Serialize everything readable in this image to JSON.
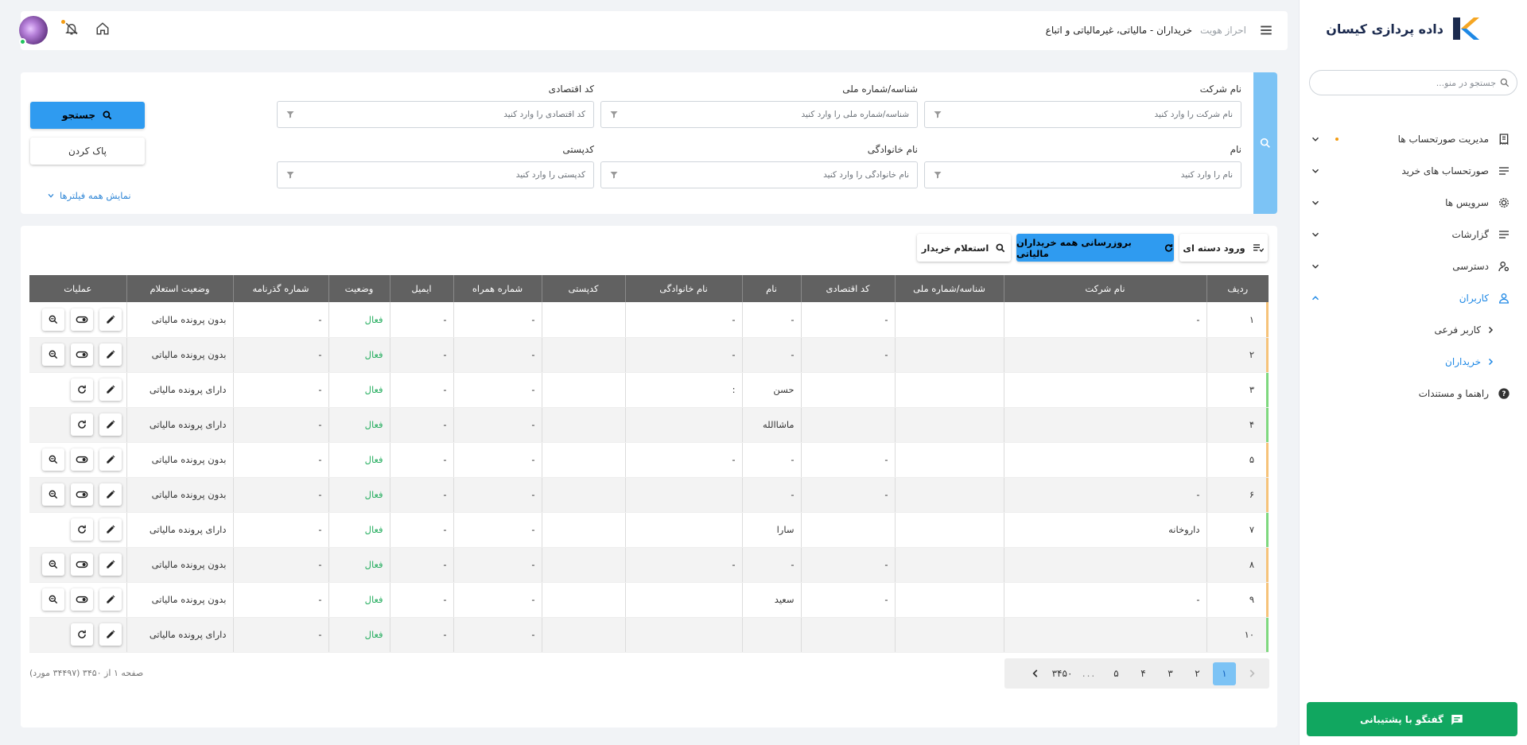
{
  "sidebar": {
    "logo_text": "داده پردازی کیسان",
    "search_placeholder": "جستجو در منو...",
    "items": [
      {
        "label": "مدیریت صورتحساب ها"
      },
      {
        "label": "صورتحساب های خرید"
      },
      {
        "label": "سرویس ها"
      },
      {
        "label": "گزارشات"
      },
      {
        "label": "دسترسی"
      },
      {
        "label": "کاربران"
      }
    ],
    "sub_items": [
      {
        "label": "کاربر فرعی"
      },
      {
        "label": "خریداران"
      }
    ],
    "help": {
      "label": "راهنما و مستندات"
    },
    "support_button": "گفتگو با پشتیبانی"
  },
  "header": {
    "breadcrumb_parent": "احراز هویت",
    "breadcrumb_current": "خریداران - مالیاتی، غیرمالیاتی و اتباع"
  },
  "filters": {
    "company_name": {
      "label": "نام شرکت",
      "placeholder": "نام شرکت را وارد کنید"
    },
    "national_id": {
      "label": "شناسه/شماره ملی",
      "placeholder": "شناسه/شماره ملی را وارد کنید"
    },
    "economic_code": {
      "label": "کد اقتصادی",
      "placeholder": "کد اقتصادی را وارد کنید"
    },
    "first_name": {
      "label": "نام",
      "placeholder": "نام را وارد کنید"
    },
    "last_name": {
      "label": "نام خانوادگی",
      "placeholder": "نام خانوادگی را وارد کنید"
    },
    "postal_code": {
      "label": "کدپستی",
      "placeholder": "کدپستی را وارد کنید"
    },
    "search_button": "جستجو",
    "clear_button": "پاک کردن",
    "show_all": "نمایش همه فیلترها"
  },
  "toolbar": {
    "bulk_import": "ورود دسته ای",
    "update_all": "بروزرسانی همه خریداران مالیاتی",
    "inquiry": "استعلام خریدار"
  },
  "table": {
    "columns": [
      "ردیف",
      "نام شرکت",
      "شناسه/شماره ملی",
      "کد اقتصادی",
      "نام",
      "نام خانوادگی",
      "کدپستی",
      "شماره همراه",
      "ایمیل",
      "وضعیت",
      "شماره گذرنامه",
      "وضعیت استعلام",
      "عملیات"
    ],
    "rows": [
      {
        "idx": "۱",
        "company": "-",
        "national": "",
        "econ": "-",
        "name": "-",
        "family": "-",
        "postal": "",
        "mobile": "-",
        "email": "-",
        "status": "فعال",
        "passport": "-",
        "inquiry": "بدون پرونده مالیاتی"
      },
      {
        "idx": "۲",
        "company": "",
        "national": "",
        "econ": "-",
        "name": "-",
        "family": "-",
        "postal": "",
        "mobile": "-",
        "email": "-",
        "status": "فعال",
        "passport": "-",
        "inquiry": "بدون پرونده مالیاتی"
      },
      {
        "idx": "۳",
        "company": "",
        "national": "",
        "econ": "",
        "name": "حسن",
        "family": ":",
        "postal": "",
        "mobile": "-",
        "email": "-",
        "status": "فعال",
        "passport": "-",
        "inquiry": "دارای پرونده مالیاتی"
      },
      {
        "idx": "۴",
        "company": "",
        "national": "",
        "econ": "",
        "name": "ماشاالله",
        "family": "",
        "postal": "",
        "mobile": "-",
        "email": "-",
        "status": "فعال",
        "passport": "-",
        "inquiry": "دارای پرونده مالیاتی"
      },
      {
        "idx": "۵",
        "company": "",
        "national": "",
        "econ": "-",
        "name": "-",
        "family": "-",
        "postal": "",
        "mobile": "-",
        "email": "-",
        "status": "فعال",
        "passport": "-",
        "inquiry": "بدون پرونده مالیاتی"
      },
      {
        "idx": "۶",
        "company": "-",
        "national": "",
        "econ": "-",
        "name": "-",
        "family": "",
        "postal": "",
        "mobile": "-",
        "email": "-",
        "status": "فعال",
        "passport": "-",
        "inquiry": "بدون پرونده مالیاتی"
      },
      {
        "idx": "۷",
        "company": "داروخانه",
        "national": "",
        "econ": "",
        "name": "سارا",
        "family": "",
        "postal": "",
        "mobile": "-",
        "email": "-",
        "status": "فعال",
        "passport": "-",
        "inquiry": "دارای پرونده مالیاتی"
      },
      {
        "idx": "۸",
        "company": "",
        "national": "",
        "econ": "-",
        "name": "-",
        "family": "-",
        "postal": "",
        "mobile": "-",
        "email": "-",
        "status": "فعال",
        "passport": "-",
        "inquiry": "بدون پرونده مالیاتی"
      },
      {
        "idx": "۹",
        "company": "-",
        "national": "",
        "econ": "-",
        "name": "سعید",
        "family": "",
        "postal": "",
        "mobile": "-",
        "email": "-",
        "status": "فعال",
        "passport": "-",
        "inquiry": "بدون پرونده مالیاتی"
      },
      {
        "idx": "۱۰",
        "company": "",
        "national": "",
        "econ": "",
        "name": "",
        "family": "",
        "postal": "",
        "mobile": "-",
        "email": "-",
        "status": "فعال",
        "passport": "-",
        "inquiry": "دارای پرونده مالیاتی"
      }
    ]
  },
  "pagination": {
    "pages": [
      "۱",
      "۲",
      "۳",
      "۴",
      "۵",
      "...",
      "۳۴۵۰"
    ],
    "current": "۱",
    "info": "صفحه ۱ از ۳۴۵۰ (۳۴۴۹۷ مورد)"
  },
  "colors": {
    "accent": "#2f9bf0",
    "support": "#11a760",
    "status_active": "#27ae60",
    "header_row": "#616161"
  }
}
